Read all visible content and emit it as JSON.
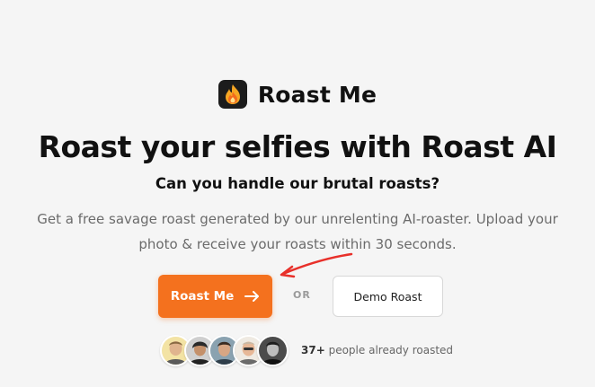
{
  "brand": {
    "name": "Roast Me",
    "logo_icon": "flame-icon"
  },
  "hero": {
    "headline": "Roast your selfies with Roast AI",
    "subheadline": "Can you handle our brutal roasts?",
    "description": "Get a free savage roast generated by our unrelenting AI-roaster. Upload your photo & receive your roasts within 30 seconds."
  },
  "cta": {
    "primary_label": "Roast Me",
    "primary_icon": "arrow-right-icon",
    "separator": "OR",
    "secondary_label": "Demo Roast"
  },
  "social_proof": {
    "avatars": [
      "avatar-1",
      "avatar-2",
      "avatar-3",
      "avatar-4",
      "avatar-5"
    ],
    "count": "37+",
    "text": "people already roasted"
  },
  "colors": {
    "accent": "#f4711e",
    "background": "#f5f5f5",
    "annotation": "#e8302a"
  }
}
